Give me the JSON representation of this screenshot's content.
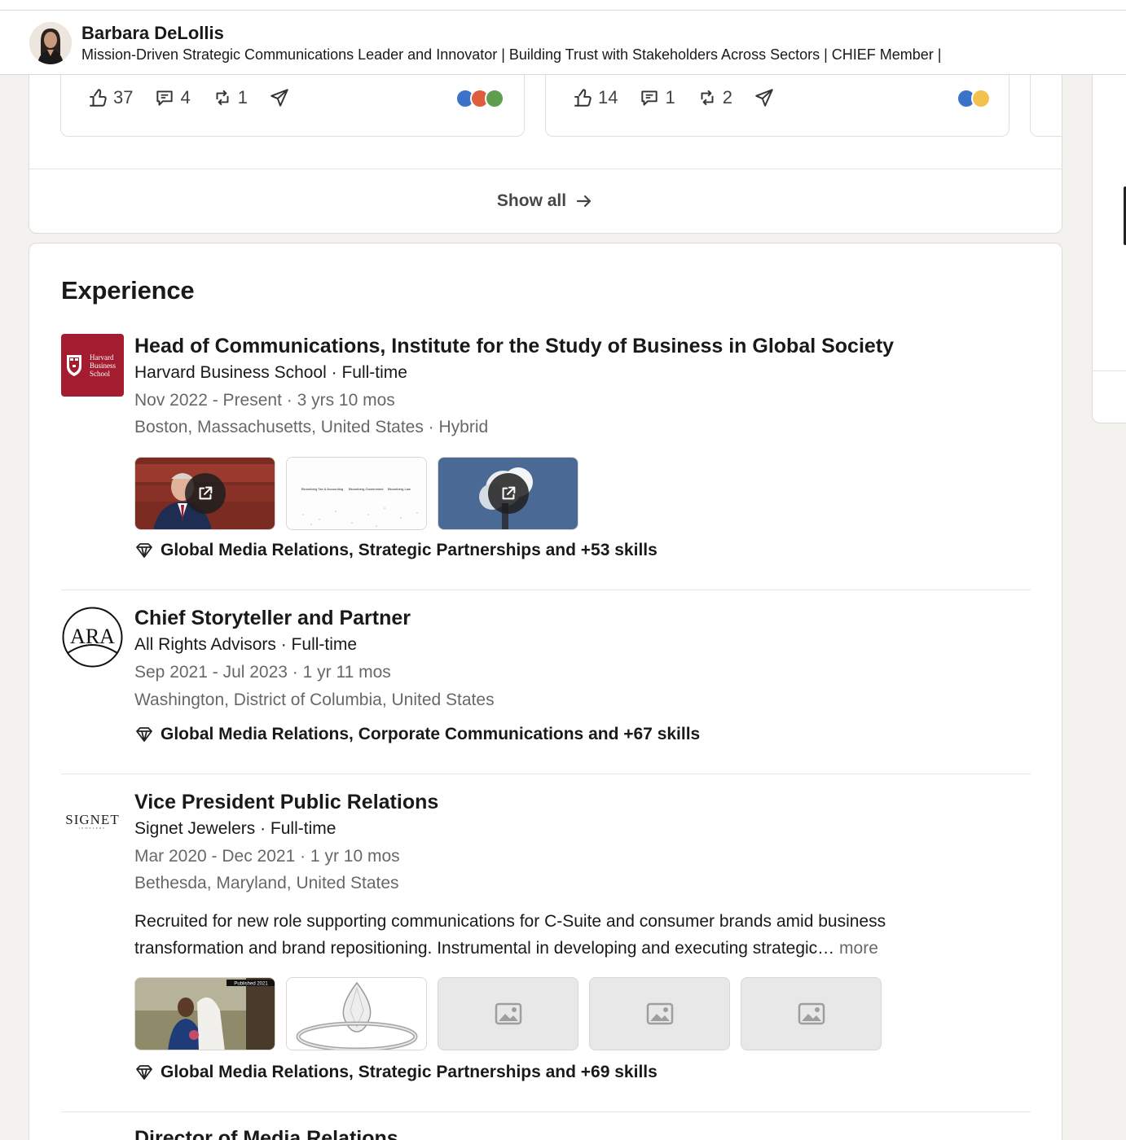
{
  "sticky_header": {
    "name": "Barbara DeLollis",
    "headline": "Mission-Driven Strategic Communications Leader and Innovator | Building Trust with Stakeholders Across Sectors | CHIEF Member |"
  },
  "activity": {
    "posts": [
      {
        "likes": "37",
        "comments": "4",
        "reposts": "1",
        "reaction_icons": [
          "like-icon",
          "love-icon",
          "support-icon"
        ]
      },
      {
        "likes": "14",
        "comments": "1",
        "reposts": "2",
        "reaction_icons": [
          "like-icon",
          "insightful-icon"
        ]
      }
    ],
    "show_all_label": "Show all"
  },
  "experience": {
    "title": "Experience",
    "jobs": [
      {
        "title": "Head of Communications, Institute for the Study of Business in Global Society",
        "company": "Harvard Business School · Full-time",
        "dates": "Nov 2022 - Present · 3 yrs 10 mos",
        "location": "Boston, Massachusetts, United States · Hybrid",
        "logo_text": [
          "Harvard",
          "Business",
          "School"
        ],
        "skills": "Global Media Relations, Strategic Partnerships and +53 skills"
      },
      {
        "title": "Chief Storyteller and Partner",
        "company": "All Rights Advisors · Full-time",
        "dates": "Sep 2021 - Jul 2023 · 1 yr 11 mos",
        "location": "Washington, District of Columbia, United States",
        "logo_text": "ARA",
        "skills": "Global Media Relations, Corporate Communications and +67 skills"
      },
      {
        "title": "Vice President Public Relations",
        "company": "Signet Jewelers · Full-time",
        "dates": "Mar 2020 - Dec 2021 · 1 yr 10 mos",
        "location": "Bethesda, Maryland, United States",
        "logo_text": "SIGNET",
        "logo_subtext": "JEWELERS",
        "description": "Recruited for new role supporting communications for C-Suite and consumer brands amid business transformation and brand repositioning. Instrumental in developing and executing strategic…",
        "more_label": "more",
        "media_badge": "Published 2021",
        "skills": "Global Media Relations, Strategic Partnerships and +69 skills"
      },
      {
        "title": "Director of Media Relations"
      }
    ],
    "media_thumb_text": [
      "Bloomberg Tax & Accounting",
      "Bloomberg Government",
      "Bloomberg Law"
    ]
  },
  "colors": {
    "hbs_crimson": "#a41c30",
    "card_bg": "#ffffff",
    "page_bg": "#f4f2ee"
  }
}
